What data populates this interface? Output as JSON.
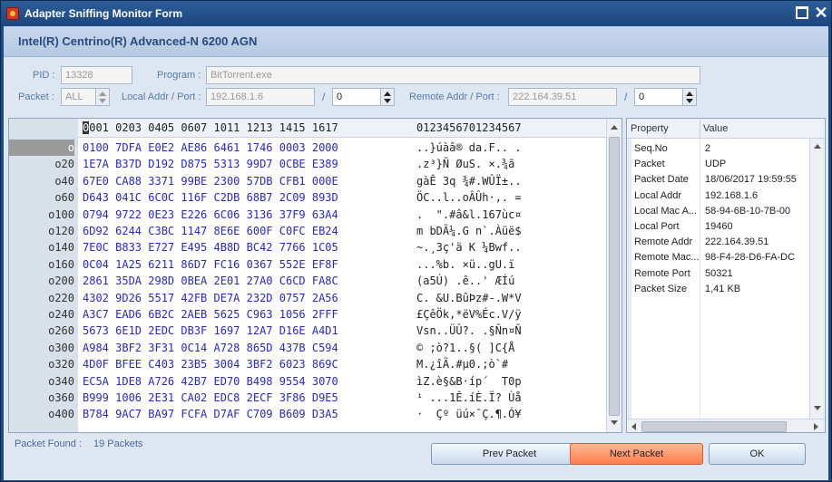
{
  "window": {
    "title": "Adapter Sniffing Monitor Form",
    "close_glyph": "✕"
  },
  "adapter": {
    "name": "Intel(R) Centrino(R) Advanced-N 6200 AGN"
  },
  "form": {
    "pid_label": "PID :",
    "pid_value": "13328",
    "program_label": "Program :",
    "program_value": "BitTorrent.exe",
    "packet_label": "Packet :",
    "packet_value": "ALL",
    "local_label": "Local Addr / Port :",
    "local_addr": "192.168.1.6",
    "local_sep": "/",
    "local_port": "0",
    "remote_label": "Remote Addr / Port :",
    "remote_addr": "222.164.39.51",
    "remote_sep": "/",
    "remote_port": "0"
  },
  "hex": {
    "header_cursor": "0",
    "header_cols": "001 0203 0405 0607 1011 1213 1415 1617",
    "header_ascii": "0123456701234567",
    "rows": [
      {
        "offset": "o",
        "bytes": "0100 7DFA E0E2 AE86 6461 1746 0003 2000",
        "ascii": "..}úàâ® da.F.. ."
      },
      {
        "offset": "o20",
        "bytes": "1E7A B37D D192 D875 5313 99D7 0CBE E389",
        "ascii": ".z³}Ñ ØuS. ×.¾ã"
      },
      {
        "offset": "o40",
        "bytes": "67E0 CA88 3371 99BE 2300 57DB CFB1 000E",
        "ascii": "gàÊ 3q ¾#.WÛÏ±.."
      },
      {
        "offset": "o60",
        "bytes": "D643 041C 6C0C 116F C2DB 68B7 2C09 893D",
        "ascii": "ÖC..l..oÂÛh·,. ="
      },
      {
        "offset": "o100",
        "bytes": "0794 9722 0E23 E226 6C06 3136 37F9 63A4",
        "ascii": ".  \".#â&l.167ùc¤"
      },
      {
        "offset": "o120",
        "bytes": "6D92 6244 C3BC 1147 8E6E 600F C0FC EB24",
        "ascii": "m bDÃ¼.G n`.Àüë$"
      },
      {
        "offset": "o140",
        "bytes": "7E0C B833 E727 E495 4B8D BC42 7766 1C05",
        "ascii": "~.¸3ç'ä K ¼Bwf.."
      },
      {
        "offset": "o160",
        "bytes": "0C04 1A25 6211 86D7 FC16 0367 552E EF8F",
        "ascii": "...%b. ×ü..gU.ï"
      },
      {
        "offset": "o200",
        "bytes": "2861 35DA 298D 0BEA 2E01 27A0 C6CD FA8C",
        "ascii": "(a5Ú) .ê..' ÆÍú"
      },
      {
        "offset": "o220",
        "bytes": "4302 9D26 5517 42FB DE7A 232D 0757 2A56",
        "ascii": "C. &U.BûÞz#-.W*V"
      },
      {
        "offset": "o240",
        "bytes": "A3C7 EAD6 6B2C 2AEB 5625 C963 1056 2FFF",
        "ascii": "£ÇêÖk,*ëV%Éc.V/ÿ"
      },
      {
        "offset": "o260",
        "bytes": "5673 6E1D 2EDC DB3F 1697 12A7 D16E A4D1",
        "ascii": "Vsn..ÜÛ?. .§Ñn¤Ñ"
      },
      {
        "offset": "o300",
        "bytes": "A984 3BF2 3F31 0C14 A728 865D 437B C594",
        "ascii": "© ;ò?1..§( ]C{Å"
      },
      {
        "offset": "o320",
        "bytes": "4D0F BFEE C403 23B5 3004 3BF2 6023 869C",
        "ascii": "M.¿îÄ.#µ0.;ò`#"
      },
      {
        "offset": "o340",
        "bytes": "EC5A 1DE8 A726 42B7 ED70 B498 9554 3070",
        "ascii": "ìZ.è§&B·íp´  T0p"
      },
      {
        "offset": "o360",
        "bytes": "B999 1006 2E31 CA02 EDC8 2ECF 3F86 D9E5",
        "ascii": "¹ ...1Ê.íÈ.Ï? Ùå"
      },
      {
        "offset": "o400",
        "bytes": "B784 9AC7 BA97 FCFA D7AF C709 B609 D3A5",
        "ascii": "·  Çº üú×¯Ç.¶.Ó¥"
      }
    ]
  },
  "properties": {
    "header_property": "Property",
    "header_value": "Value",
    "rows": [
      {
        "key": "Seq.No",
        "value": "2"
      },
      {
        "key": "Packet",
        "value": "UDP"
      },
      {
        "key": "Packet Date",
        "value": "18/06/2017 19:59:55"
      },
      {
        "key": "Local Addr",
        "value": "192.168.1.6"
      },
      {
        "key": "Local Mac A...",
        "value": "58-94-6B-10-7B-00"
      },
      {
        "key": "Local Port",
        "value": "19460"
      },
      {
        "key": "Remote Addr",
        "value": "222.164.39.51"
      },
      {
        "key": "Remote Mac...",
        "value": "98-F4-28-D6-FA-DC"
      },
      {
        "key": "Remote Port",
        "value": "50321"
      },
      {
        "key": "Packet Size",
        "value": "1,41 KB"
      }
    ]
  },
  "status": {
    "found_label": "Packet Found :",
    "found_value": "19 Packets"
  },
  "buttons": {
    "prev": "Prev Packet",
    "next": "Next Packet",
    "ok": "OK"
  },
  "colors": {
    "title_bar": "#1c4680",
    "hex_bytes": "#2a2ab0",
    "next_button": "#ff7e4e"
  }
}
